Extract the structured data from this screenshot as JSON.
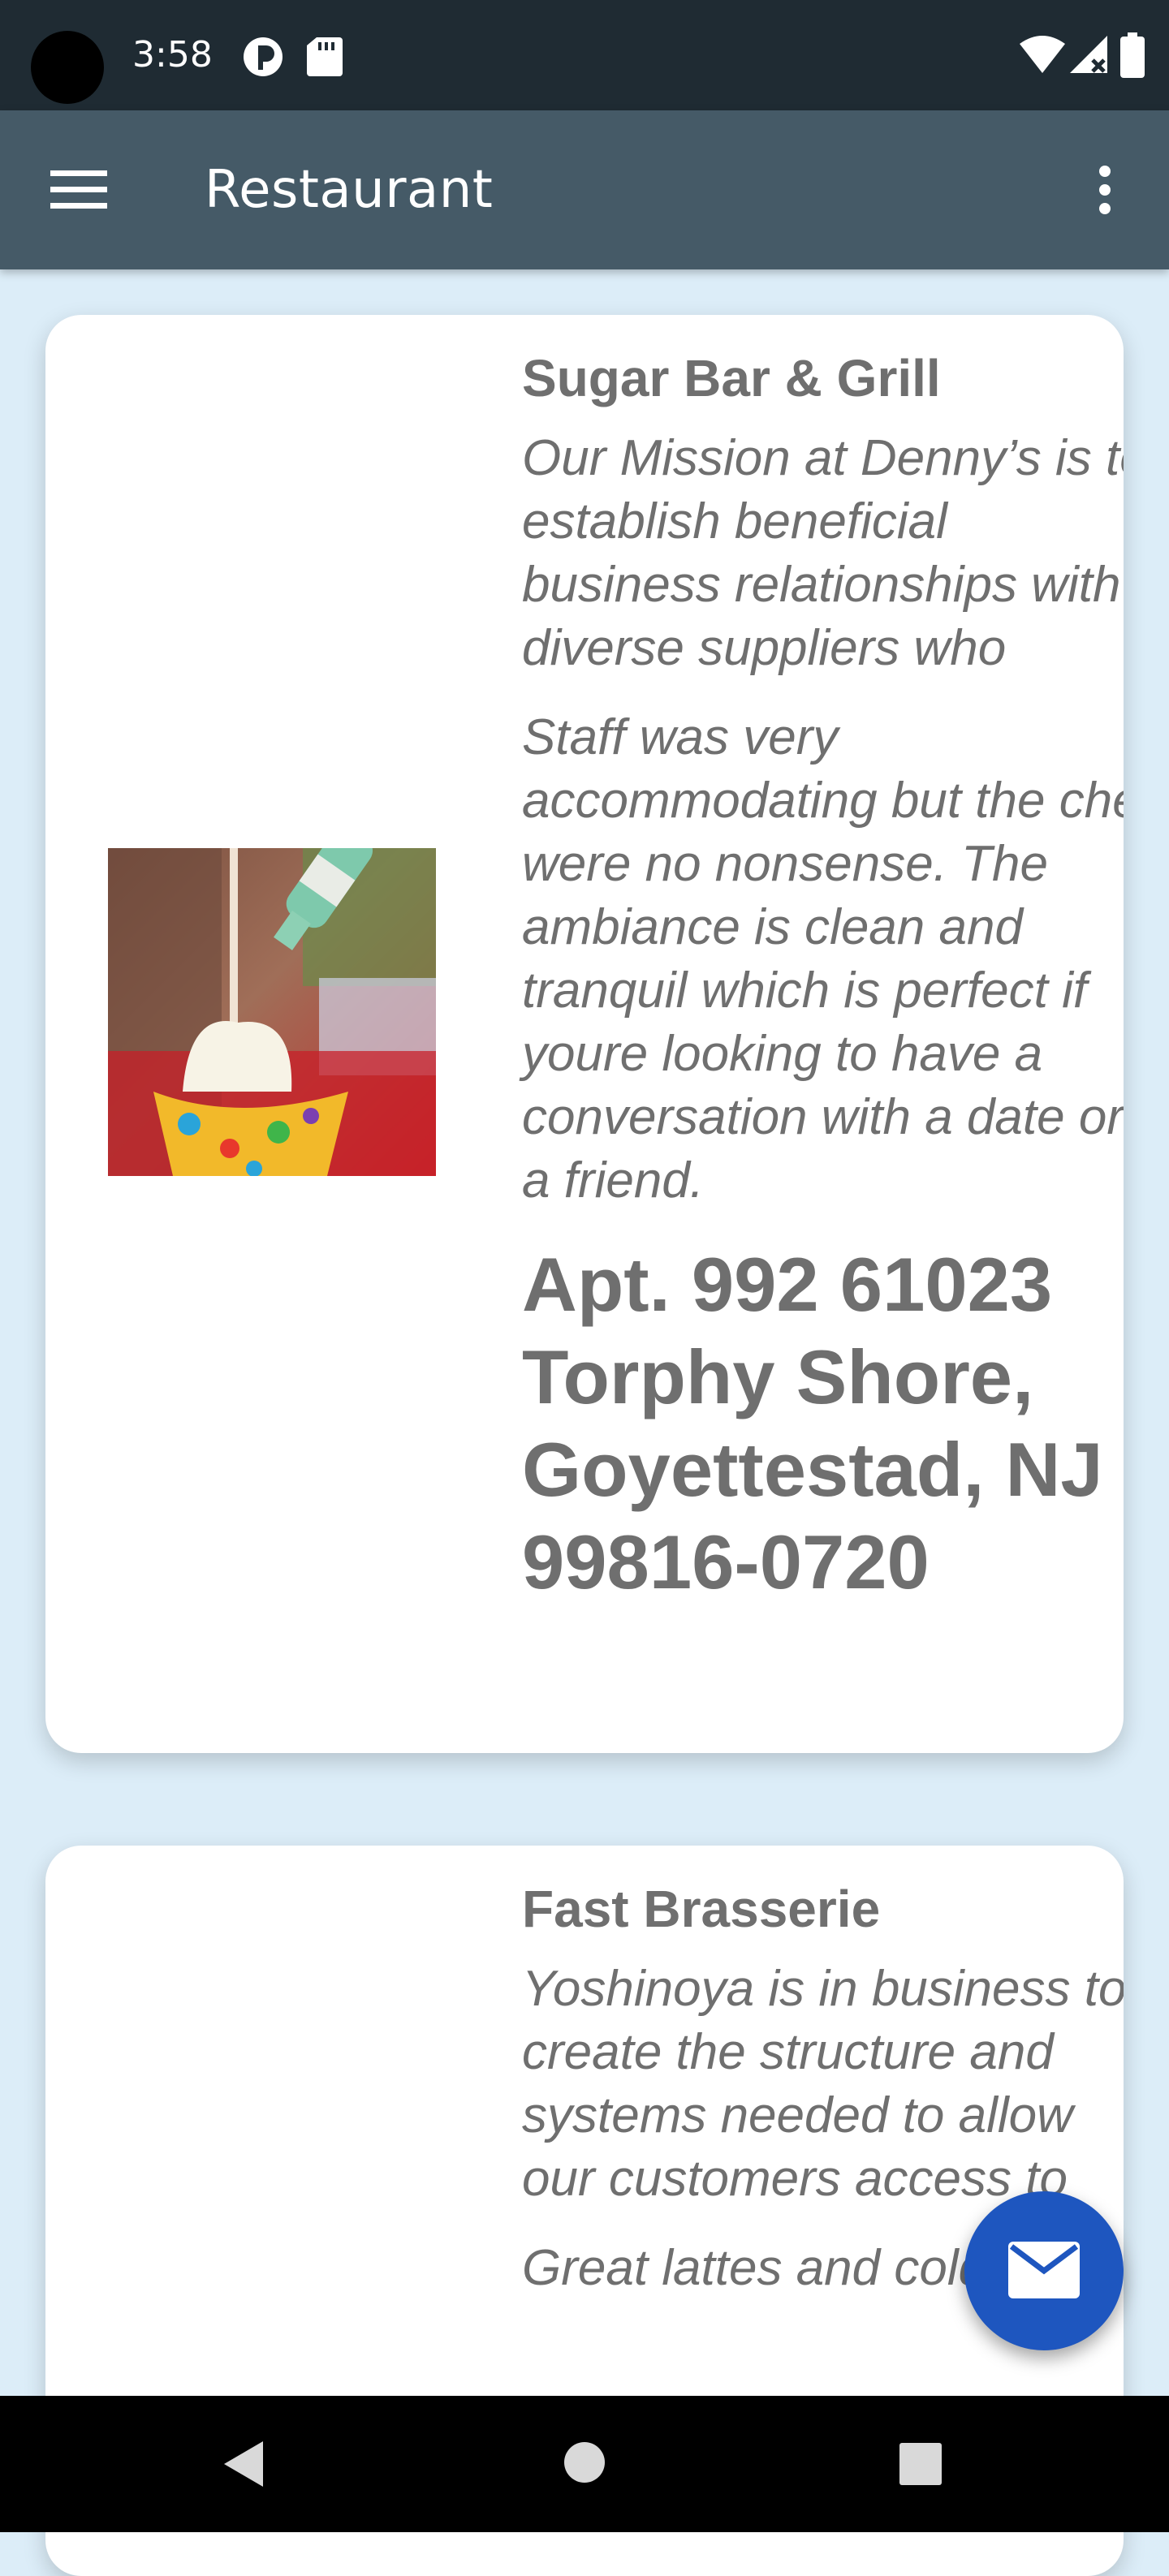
{
  "status_bar": {
    "time": "3:58"
  },
  "app_bar": {
    "title": "Restaurant"
  },
  "restaurants": [
    {
      "name": "Sugar Bar & Grill",
      "mission": "Our Mission at Denny’s is to establish beneficial business relationships with diverse suppliers who",
      "review": "Staff was very accommodating but the chef were no nonsense. The ambiance is clean and tranquil which is perfect if youre looking to have a conversation with a date or a friend.",
      "address": "Apt. 992 61023 Torphy Shore, Goyettestad, NJ 99816-0720"
    },
    {
      "name": "Fast Brasserie",
      "mission": "Yoshinoya is in business to create the structure and systems needed to allow our customers access to",
      "review": "Great lattes and cold"
    }
  ],
  "colors": {
    "status_bar": "#1f2b33",
    "app_bar": "#455a67",
    "background": "#dcedf8",
    "fab": "#1e56bf",
    "text": "#6f6f6f"
  },
  "icons": [
    "camera-cutout",
    "sim-icon",
    "sd-card-icon",
    "wifi-icon",
    "signal-icon",
    "battery-icon",
    "menu-icon",
    "more-vert-icon",
    "email-icon",
    "back-icon",
    "home-icon",
    "recents-icon"
  ]
}
